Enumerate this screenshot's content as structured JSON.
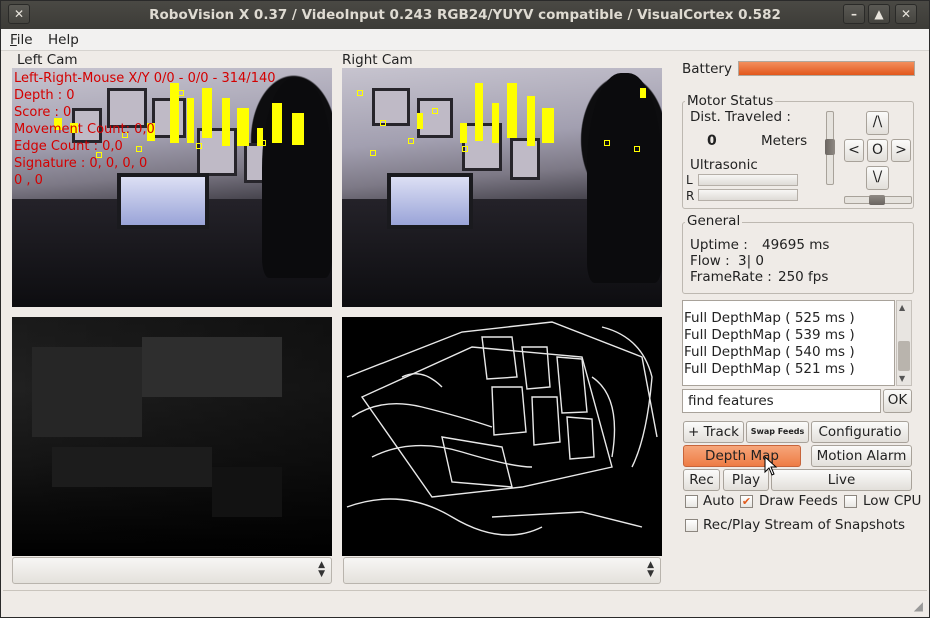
{
  "window": {
    "title": "RoboVision X 0.37 / VideoInput 0.243 RGB24/YUYV compatible / VisualCortex 0.582",
    "controls": {
      "close": "✕",
      "minimize": "–",
      "maximize": "▲",
      "restore": "✕"
    }
  },
  "menu": [
    {
      "label": "File",
      "accel": "F",
      "rest": "ile"
    },
    {
      "label": "Help",
      "accel": "",
      "rest": "Help"
    }
  ],
  "left_cam": {
    "label": "Left Cam",
    "overlay": [
      "Left-Right-Mouse X/Y 0/0 - 0/0 - 314/140",
      "Depth : 0",
      "Score : 0",
      "Movement Count: 0,0",
      "Edge Count : 0,0",
      "Signature : 0, 0, 0, 0",
      "0 , 0"
    ]
  },
  "right_cam": {
    "label": "Right Cam"
  },
  "battery": {
    "label": "Battery",
    "level": 1.0,
    "color": "#e8652b"
  },
  "motor_status": {
    "title": "Motor Status",
    "dist_label": "Dist. Traveled :",
    "dist_value": "0",
    "dist_unit": "Meters",
    "ultrasonic_label": "Ultrasonic",
    "left_label": "L",
    "right_label": "R",
    "pad": {
      "up": "/\\",
      "left": "<",
      "center": "O",
      "right": ">",
      "down": "\\/"
    }
  },
  "general": {
    "title": "General",
    "uptime_label": "Uptime :",
    "uptime_value": "49695 ms",
    "flow_label": "Flow :",
    "flow_value": "3| 0",
    "framerate_label": "FrameRate :",
    "framerate_value": "250 fps"
  },
  "log": [
    "Full DepthMap ( 525 ms )",
    "Full DepthMap ( 539 ms )",
    "Full DepthMap ( 540 ms )",
    "Full DepthMap ( 521 ms )"
  ],
  "command": {
    "value": "find features",
    "ok_label": "OK"
  },
  "buttons": {
    "track": "+ Track",
    "swap": "Swap Feeds",
    "config": "Configuratio",
    "depth_map": "Depth Map",
    "motion_alarm": "Motion Alarm",
    "rec": "Rec",
    "play": "Play",
    "live": "Live"
  },
  "checkboxes": {
    "auto": {
      "label": "Auto",
      "checked": false
    },
    "draw_feeds": {
      "label": "Draw Feeds",
      "checked": true
    },
    "low_cpu": {
      "label": "Low CPU",
      "checked": false
    },
    "rec_play_stream": {
      "label": "Rec/Play Stream of Snapshots",
      "checked": false
    }
  },
  "accent_color": "#ee7c45"
}
